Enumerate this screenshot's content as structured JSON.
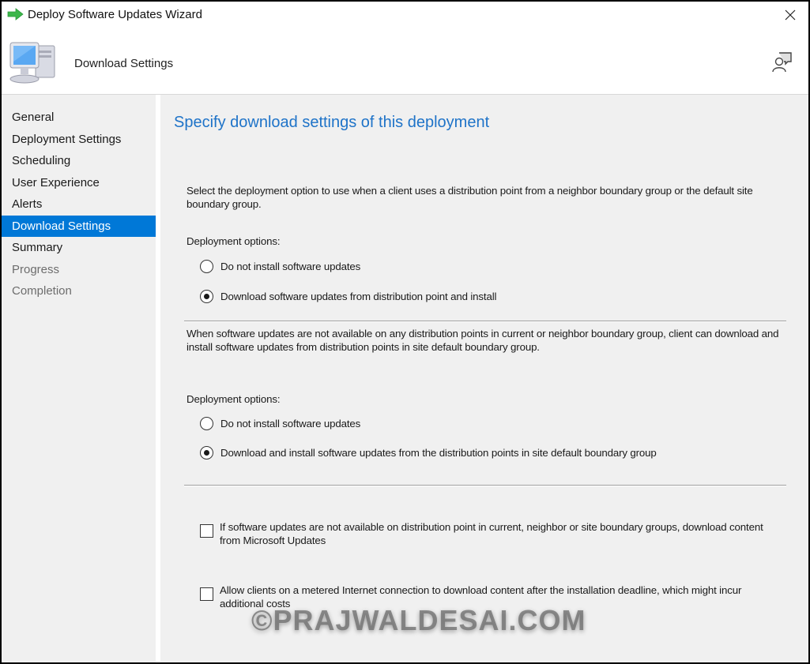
{
  "window": {
    "title": "Deploy Software Updates Wizard",
    "title_icon": "green-arrow-icon",
    "close_icon": "close-icon"
  },
  "header": {
    "title": "Download Settings",
    "icon": "computer-icon",
    "help_icon": "user-help-icon"
  },
  "nav": {
    "items": [
      {
        "label": "General",
        "state": "normal"
      },
      {
        "label": "Deployment Settings",
        "state": "normal"
      },
      {
        "label": "Scheduling",
        "state": "normal"
      },
      {
        "label": "User Experience",
        "state": "normal"
      },
      {
        "label": "Alerts",
        "state": "normal"
      },
      {
        "label": "Download Settings",
        "state": "active"
      },
      {
        "label": "Summary",
        "state": "normal"
      },
      {
        "label": "Progress",
        "state": "disabled"
      },
      {
        "label": "Completion",
        "state": "disabled"
      }
    ]
  },
  "content": {
    "heading": "Specify download settings of this deployment",
    "section1": {
      "description": "Select the deployment option to use when a client uses a distribution point from a neighbor boundary group or the default site boundary group.",
      "options_label": "Deployment options:",
      "options": [
        {
          "label": "Do not install software updates",
          "checked": false
        },
        {
          "label": "Download software updates from distribution point and install",
          "checked": true
        }
      ]
    },
    "section2": {
      "description": "When software updates are not available on any distribution points in current or neighbor boundary group, client can download and install software updates from distribution points in site default boundary group.",
      "options_label": "Deployment options:",
      "options": [
        {
          "label": "Do not install software updates",
          "checked": false
        },
        {
          "label": "Download and install software updates from the distribution points in site default boundary group",
          "checked": true
        }
      ]
    },
    "checkboxes": [
      {
        "label": "If software updates are not available on distribution point in current, neighbor or site boundary groups, download content from Microsoft Updates",
        "checked": false
      },
      {
        "label": "Allow clients on a metered Internet connection to download content after the installation deadline, which might incur additional costs",
        "checked": false
      }
    ]
  },
  "watermark": "©PRAJWALDESAI.COM",
  "colors": {
    "accent": "#0078d7",
    "heading": "#1e73c8",
    "panel_bg": "#f0f0f0"
  }
}
